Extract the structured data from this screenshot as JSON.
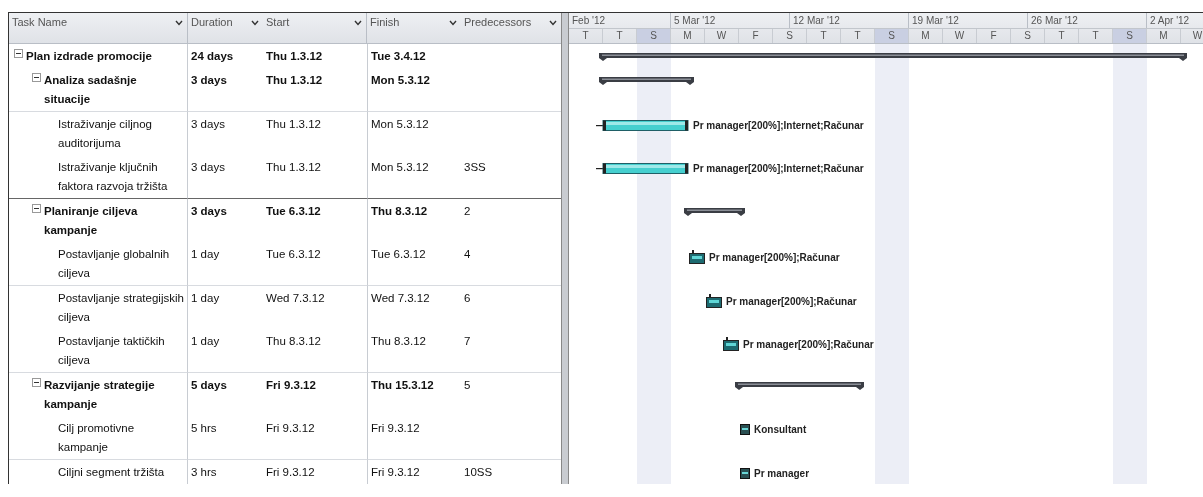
{
  "table": {
    "columns": [
      "Task Name",
      "Duration",
      "Start",
      "Finish",
      "Predecessors"
    ]
  },
  "tasks": [
    {
      "name": "Plan izdrade promocije",
      "duration": "24 days",
      "start": "Thu 1.3.12",
      "finish": "Tue 3.4.12",
      "kind": "summary",
      "expanded": true,
      "children": [
        {
          "name": "Analiza sadašnje situacije",
          "duration": "3 days",
          "start": "Thu 1.3.12",
          "finish": "Mon 5.3.12",
          "kind": "summary",
          "expanded": true,
          "children": [
            {
              "name": "Istraživanje ciljnog auditorijuma",
              "duration": "3 days",
              "start": "Thu 1.3.12",
              "finish": "Mon 5.3.12",
              "kind": "task",
              "resources": "Pr manager[200%];Internet;Računar"
            },
            {
              "name": "Istraživanje ključnih faktora razvoja tržišta",
              "duration": "3 days",
              "start": "Thu 1.3.12",
              "finish": "Mon 5.3.12",
              "predecessors": "3SS",
              "kind": "task",
              "resources": "Pr manager[200%];Internet;Računar"
            }
          ]
        },
        {
          "name": "Planiranje ciljeva kampanje",
          "duration": "3 days",
          "start": "Tue 6.3.12",
          "finish": "Thu 8.3.12",
          "predecessors": "2",
          "kind": "summary",
          "expanded": true,
          "children": [
            {
              "name": "Postavljanje globalnih ciljeva",
              "duration": "1 day",
              "start": "Tue 6.3.12",
              "finish": "Tue 6.3.12",
              "predecessors": "4",
              "kind": "day_task",
              "resources": "Pr manager[200%];Računar"
            },
            {
              "name": "Postavljanje strategijskih ciljeva",
              "duration": "1 day",
              "start": "Wed 7.3.12",
              "finish": "Wed 7.3.12",
              "predecessors": "6",
              "kind": "day_task",
              "resources": "Pr manager[200%];Računar"
            },
            {
              "name": "Postavljanje taktičkih ciljeva",
              "duration": "1 day",
              "start": "Thu 8.3.12",
              "finish": "Thu 8.3.12",
              "predecessors": "7",
              "kind": "day_task",
              "resources": "Pr manager[200%];Računar"
            }
          ]
        },
        {
          "name": "Razvijanje strategije kampanje",
          "duration": "5 days",
          "start": "Fri 9.3.12",
          "finish": "Thu 15.3.12",
          "predecessors": "5",
          "kind": "summary",
          "expanded": true,
          "children": [
            {
              "name": "Cilj promotivne kampanje",
              "duration": "5 hrs",
              "start": "Fri 9.3.12",
              "finish": "Fri 9.3.12",
              "kind": "hour_task",
              "resources": "Konsultant"
            },
            {
              "name": "Ciljni segment tržišta",
              "duration": "3 hrs",
              "start": "Fri 9.3.12",
              "finish": "Fri 9.3.12",
              "predecessors": "10SS",
              "kind": "hour_task",
              "resources": "Pr manager"
            }
          ]
        }
      ]
    }
  ],
  "timescale": {
    "top": [
      "Feb '12",
      "5 Mar '12",
      "12 Mar '12",
      "19 Mar '12",
      "26 Mar '12",
      "2 Apr '12"
    ],
    "bottom": [
      {
        "label": "T",
        "shaded": false
      },
      {
        "label": "T",
        "shaded": false
      },
      {
        "label": "S",
        "shaded": true
      },
      {
        "label": "M",
        "shaded": false
      },
      {
        "label": "W",
        "shaded": false
      },
      {
        "label": "F",
        "shaded": false
      },
      {
        "label": "S",
        "shaded": false
      },
      {
        "label": "T",
        "shaded": false
      },
      {
        "label": "T",
        "shaded": false
      },
      {
        "label": "S",
        "shaded": true
      },
      {
        "label": "M",
        "shaded": false
      },
      {
        "label": "W",
        "shaded": false
      },
      {
        "label": "F",
        "shaded": false
      },
      {
        "label": "S",
        "shaded": false
      },
      {
        "label": "T",
        "shaded": false
      },
      {
        "label": "T",
        "shaded": false
      },
      {
        "label": "S",
        "shaded": true
      },
      {
        "label": "M",
        "shaded": false
      },
      {
        "label": "W",
        "shaded": false
      }
    ]
  }
}
